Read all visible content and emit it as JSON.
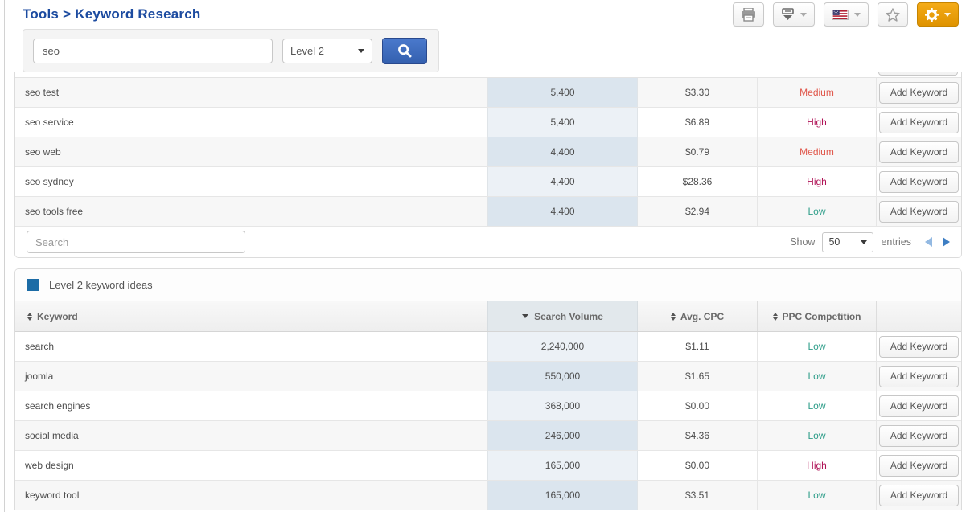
{
  "breadcrumb": {
    "section": "Tools",
    "separator": ">",
    "title": "Keyword Research"
  },
  "toolbar": {
    "icons": [
      "print-icon",
      "export-download-icon",
      "us-flag-icon",
      "favorite-star-icon",
      "settings-gear-icon"
    ],
    "gear_button_color": "#eda712"
  },
  "search_bar": {
    "keyword_value": "seo",
    "level_selected": "Level 2"
  },
  "labels": {
    "add_keyword": "Add Keyword",
    "search_placeholder": "Search",
    "show": "Show",
    "entries": "entries",
    "page_size": "50"
  },
  "table1": {
    "rows": [
      {
        "keyword": "seo test",
        "search_volume": "5,400",
        "avg_cpc": "$3.30",
        "ppc_competition": "Medium"
      },
      {
        "keyword": "seo service",
        "search_volume": "5,400",
        "avg_cpc": "$6.89",
        "ppc_competition": "High"
      },
      {
        "keyword": "seo web",
        "search_volume": "4,400",
        "avg_cpc": "$0.79",
        "ppc_competition": "Medium"
      },
      {
        "keyword": "seo sydney",
        "search_volume": "4,400",
        "avg_cpc": "$28.36",
        "ppc_competition": "High"
      },
      {
        "keyword": "seo tools free",
        "search_volume": "4,400",
        "avg_cpc": "$2.94",
        "ppc_competition": "Low"
      }
    ]
  },
  "section2": {
    "title": "Level 2 keyword ideas",
    "legend_color": "#1c6ca6"
  },
  "table2": {
    "headers": {
      "keyword": "Keyword",
      "search_volume": "Search Volume",
      "avg_cpc": "Avg. CPC",
      "ppc_competition": "PPC Competition"
    },
    "sorted_by": "search_volume_desc",
    "rows": [
      {
        "keyword": "search",
        "search_volume": "2,240,000",
        "avg_cpc": "$1.11",
        "ppc_competition": "Low"
      },
      {
        "keyword": "joomla",
        "search_volume": "550,000",
        "avg_cpc": "$1.65",
        "ppc_competition": "Low"
      },
      {
        "keyword": "search engines",
        "search_volume": "368,000",
        "avg_cpc": "$0.00",
        "ppc_competition": "Low"
      },
      {
        "keyword": "social media",
        "search_volume": "246,000",
        "avg_cpc": "$4.36",
        "ppc_competition": "Low"
      },
      {
        "keyword": "web design",
        "search_volume": "165,000",
        "avg_cpc": "$0.00",
        "ppc_competition": "High"
      },
      {
        "keyword": "keyword tool",
        "search_volume": "165,000",
        "avg_cpc": "$3.51",
        "ppc_competition": "Low"
      }
    ]
  },
  "status_colors": {
    "low": "#2f9e8a",
    "medium": "#e0564a",
    "high": "#b01457",
    "accent_blue": "#1c4ba0"
  }
}
